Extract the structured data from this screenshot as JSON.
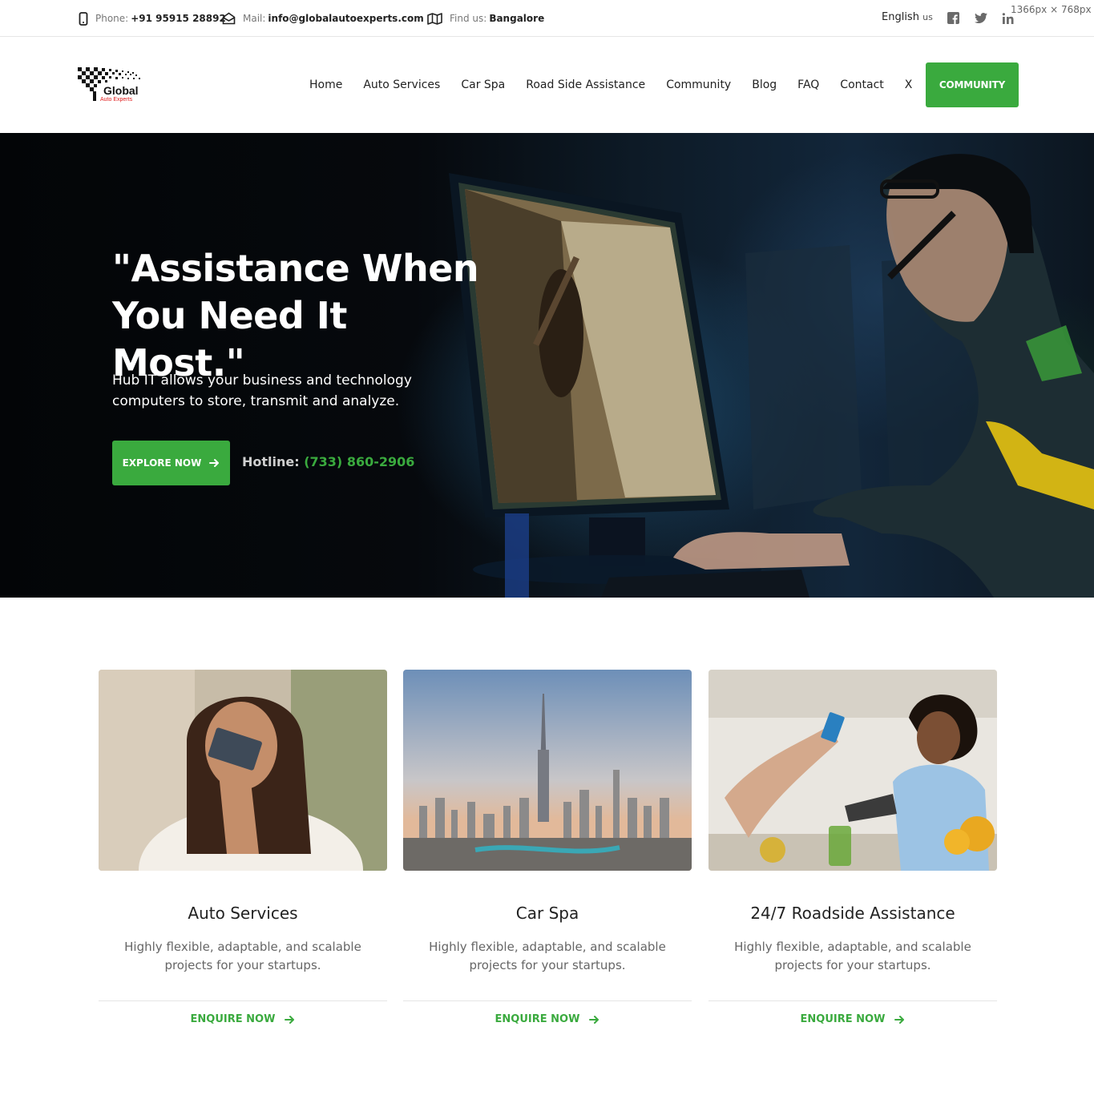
{
  "topbar": {
    "phone_label": "Phone:",
    "phone_value": "+91 95915 28892",
    "mail_label": "Mail:",
    "mail_value": "info@globalautoexperts.com",
    "find_label": "Find us:",
    "find_value": "Bangalore",
    "language": "English",
    "language_code": "us",
    "viewport_note": "1366px × 768px",
    "social_icons": [
      "facebook-icon",
      "twitter-icon",
      "linkedin-icon"
    ]
  },
  "brand": {
    "logo_name": "Global",
    "logo_tagline": "Auto Experts",
    "accent_color": "#3aaa3e"
  },
  "nav": {
    "items": [
      "Home",
      "Auto Services",
      "Car Spa",
      "Road Side Assistance",
      "Community",
      "Blog",
      "FAQ",
      "Contact",
      "X"
    ],
    "cta": "COMMUNITY"
  },
  "hero": {
    "title": "\"Assistance When You Need It Most.\"",
    "subtitle": "Hub IT allows your business and technology computers to store, transmit and analyze.",
    "button": "EXPLORE NOW",
    "hotline_label": "Hotline:",
    "hotline_number": "(733) 860-2906"
  },
  "cards": [
    {
      "title": "Auto Services",
      "text": "Highly flexible, adaptable, and scalable projects for your startups.",
      "link": "ENQUIRE NOW"
    },
    {
      "title": "Car Spa",
      "text": "Highly flexible, adaptable, and scalable projects for your startups.",
      "link": "ENQUIRE NOW"
    },
    {
      "title": "24/7 Roadside Assistance",
      "text": "Highly flexible, adaptable, and scalable projects for your startups.",
      "link": "ENQUIRE NOW"
    }
  ]
}
